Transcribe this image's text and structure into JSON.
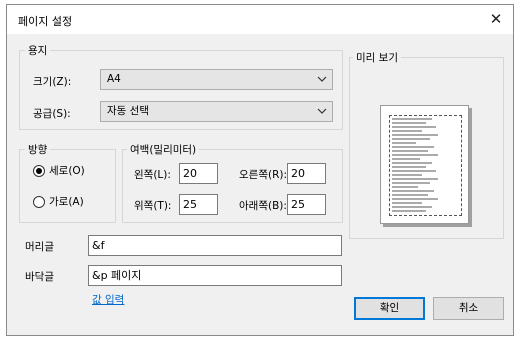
{
  "window": {
    "title": "페이지 설정",
    "close_glyph": "✕"
  },
  "paper": {
    "legend": "용지",
    "size_label": "크기(Z):",
    "size_value": "A4",
    "source_label": "공급(S):",
    "source_value": "자동 선택"
  },
  "orientation": {
    "legend": "방향",
    "portrait_label": "세로(O)",
    "landscape_label": "가로(A)",
    "selected": "portrait"
  },
  "margins": {
    "legend": "여백(밀리미터)",
    "left_label": "왼쪽(L):",
    "left_value": "20",
    "right_label": "오른쪽(R):",
    "right_value": "20",
    "top_label": "위쪽(T):",
    "top_value": "25",
    "bottom_label": "아래쪽(B):",
    "bottom_value": "25"
  },
  "header": {
    "label": "머리글",
    "value": "&f"
  },
  "footer": {
    "label": "바닥글",
    "value": "&p 페이지"
  },
  "link": {
    "label": "값 입력"
  },
  "preview": {
    "legend": "미리 보기"
  },
  "buttons": {
    "ok": "확인",
    "cancel": "취소"
  },
  "icons": {
    "combo_arrow": "chevron-down-icon",
    "close": "close-icon"
  }
}
